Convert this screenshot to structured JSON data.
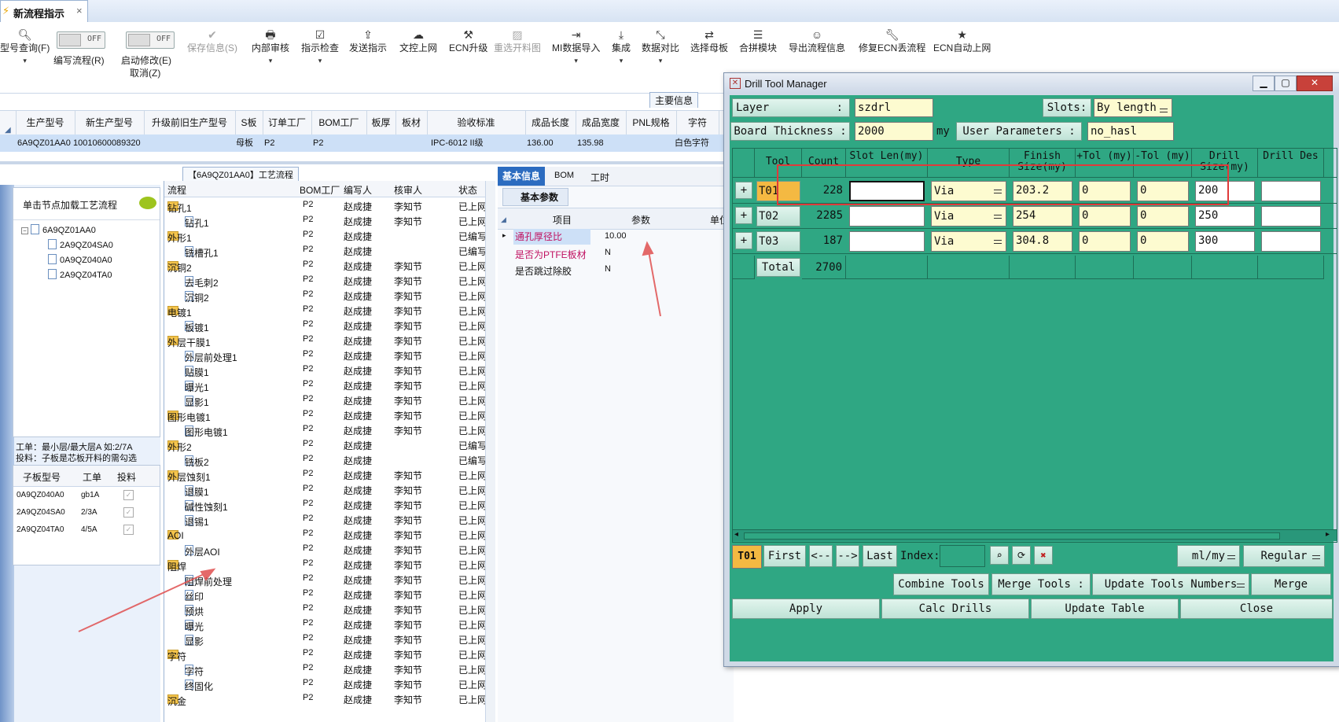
{
  "tab": {
    "title": "新流程指示",
    "close": "×"
  },
  "toolbar": {
    "items": [
      {
        "label": "型号查询(F)",
        "icon": "search-icon"
      },
      {
        "label": "编写流程(R)"
      },
      {
        "label": "启动修改(E)",
        "sub": "取消(Z)"
      },
      {
        "label": "保存信息(S)",
        "icon": "check-icon"
      },
      {
        "label": "内部审核",
        "icon": "print-icon"
      },
      {
        "label": "指示检查",
        "icon": "checkbox-icon"
      },
      {
        "label": "发送指示",
        "icon": "send-icon"
      },
      {
        "label": "文控上网",
        "icon": "cloud-icon"
      },
      {
        "label": "ECN升级",
        "icon": "ecn-icon"
      },
      {
        "label": "重选开料图",
        "icon": "image-icon"
      },
      {
        "label": "MI数据导入",
        "icon": "import-icon"
      },
      {
        "label": "集成",
        "icon": "download-icon"
      },
      {
        "label": "数据对比",
        "icon": "compare-icon"
      },
      {
        "label": "选择母板",
        "icon": "shuffle-icon"
      },
      {
        "label": "合拼模块",
        "icon": "list-icon"
      },
      {
        "label": "导出流程信息",
        "icon": "smile-icon"
      },
      {
        "label": "修复ECN丢流程",
        "icon": "wrench-icon"
      },
      {
        "label": "ECN自动上网",
        "icon": "star-icon"
      }
    ],
    "toggle_text": "OFF",
    "main_info": "主要信息"
  },
  "grid": {
    "headers": [
      "生产型号",
      "新生产型号",
      "升级前旧生产型号",
      "S板",
      "订单工厂",
      "BOM工厂",
      "板厚",
      "板材",
      "验收标准",
      "成品长度",
      "成品宽度",
      "PNL规格",
      "字符"
    ],
    "row": [
      "6A9QZ01AA0",
      "10010600089320",
      "母板",
      "P2",
      "P2",
      "IPC-6012 II级",
      "136.00",
      "135.98",
      "白色字符"
    ]
  },
  "left": {
    "section_label": "【6A9QZ01AA0】工艺流程",
    "tree_title": "单击节点加载工艺流程",
    "tree_root": "6A9QZ01AA0",
    "tree_children": [
      "2A9QZ04SA0",
      "0A9QZ040A0",
      "2A9QZ04TA0"
    ],
    "note1": "工单：最小层/最大层A 如:2/7A",
    "note2": "投料：子板是芯板开料的需勾选",
    "sub_headers": [
      "子板型号",
      "工单",
      "投料"
    ],
    "sub_rows": [
      [
        "0A9QZ040A0",
        "gb1A"
      ],
      [
        "2A9QZ04SA0",
        "2/3A"
      ],
      [
        "2A9QZ04TA0",
        "4/5A"
      ]
    ]
  },
  "process": {
    "headers": [
      "流程",
      "BOM工厂",
      "编写人",
      "核审人",
      "状态"
    ],
    "rows": [
      {
        "name": "钻孔1",
        "lvl": 0,
        "f": "P2",
        "w": "赵成捷",
        "r": "李知节",
        "s": "已上网"
      },
      {
        "name": "钻孔1",
        "lvl": 1,
        "f": "P2",
        "w": "赵成捷",
        "r": "李知节",
        "s": "已上网"
      },
      {
        "name": "外形1",
        "lvl": 0,
        "f": "P2",
        "w": "赵成捷",
        "r": "",
        "s": "已编写"
      },
      {
        "name": "铣槽孔1",
        "lvl": 1,
        "f": "P2",
        "w": "赵成捷",
        "r": "",
        "s": "已编写"
      },
      {
        "name": "沉铜2",
        "lvl": 0,
        "f": "P2",
        "w": "赵成捷",
        "r": "李知节",
        "s": "已上网"
      },
      {
        "name": "去毛刺2",
        "lvl": 1,
        "f": "P2",
        "w": "赵成捷",
        "r": "李知节",
        "s": "已上网"
      },
      {
        "name": "沉铜2",
        "lvl": 1,
        "f": "P2",
        "w": "赵成捷",
        "r": "李知节",
        "s": "已上网"
      },
      {
        "name": "电镀1",
        "lvl": 0,
        "f": "P2",
        "w": "赵成捷",
        "r": "李知节",
        "s": "已上网"
      },
      {
        "name": "板镀1",
        "lvl": 1,
        "f": "P2",
        "w": "赵成捷",
        "r": "李知节",
        "s": "已上网"
      },
      {
        "name": "外层干膜1",
        "lvl": 0,
        "f": "P2",
        "w": "赵成捷",
        "r": "李知节",
        "s": "已上网"
      },
      {
        "name": "外层前处理1",
        "lvl": 1,
        "f": "P2",
        "w": "赵成捷",
        "r": "李知节",
        "s": "已上网"
      },
      {
        "name": "贴膜1",
        "lvl": 1,
        "f": "P2",
        "w": "赵成捷",
        "r": "李知节",
        "s": "已上网"
      },
      {
        "name": "曝光1",
        "lvl": 1,
        "f": "P2",
        "w": "赵成捷",
        "r": "李知节",
        "s": "已上网"
      },
      {
        "name": "显影1",
        "lvl": 1,
        "f": "P2",
        "w": "赵成捷",
        "r": "李知节",
        "s": "已上网"
      },
      {
        "name": "图形电镀1",
        "lvl": 0,
        "f": "P2",
        "w": "赵成捷",
        "r": "李知节",
        "s": "已上网"
      },
      {
        "name": "图形电镀1",
        "lvl": 1,
        "f": "P2",
        "w": "赵成捷",
        "r": "李知节",
        "s": "已上网"
      },
      {
        "name": "外形2",
        "lvl": 0,
        "f": "P2",
        "w": "赵成捷",
        "r": "",
        "s": "已编写"
      },
      {
        "name": "铣板2",
        "lvl": 1,
        "f": "P2",
        "w": "赵成捷",
        "r": "",
        "s": "已编写"
      },
      {
        "name": "外层蚀刻1",
        "lvl": 0,
        "f": "P2",
        "w": "赵成捷",
        "r": "李知节",
        "s": "已上网"
      },
      {
        "name": "退膜1",
        "lvl": 1,
        "f": "P2",
        "w": "赵成捷",
        "r": "李知节",
        "s": "已上网"
      },
      {
        "name": "碱性蚀刻1",
        "lvl": 1,
        "f": "P2",
        "w": "赵成捷",
        "r": "李知节",
        "s": "已上网"
      },
      {
        "name": "退锡1",
        "lvl": 1,
        "f": "P2",
        "w": "赵成捷",
        "r": "李知节",
        "s": "已上网"
      },
      {
        "name": "AOI",
        "lvl": 0,
        "f": "P2",
        "w": "赵成捷",
        "r": "李知节",
        "s": "已上网"
      },
      {
        "name": "外层AOI",
        "lvl": 1,
        "f": "P2",
        "w": "赵成捷",
        "r": "李知节",
        "s": "已上网"
      },
      {
        "name": "阻焊",
        "lvl": 0,
        "f": "P2",
        "w": "赵成捷",
        "r": "李知节",
        "s": "已上网"
      },
      {
        "name": "阻焊前处理",
        "lvl": 1,
        "f": "P2",
        "w": "赵成捷",
        "r": "李知节",
        "s": "已上网"
      },
      {
        "name": "丝印",
        "lvl": 1,
        "f": "P2",
        "w": "赵成捷",
        "r": "李知节",
        "s": "已上网"
      },
      {
        "name": "预烘",
        "lvl": 1,
        "f": "P2",
        "w": "赵成捷",
        "r": "李知节",
        "s": "已上网"
      },
      {
        "name": "曝光",
        "lvl": 1,
        "f": "P2",
        "w": "赵成捷",
        "r": "李知节",
        "s": "已上网"
      },
      {
        "name": "显影",
        "lvl": 1,
        "f": "P2",
        "w": "赵成捷",
        "r": "李知节",
        "s": "已上网"
      },
      {
        "name": "字符",
        "lvl": 0,
        "f": "P2",
        "w": "赵成捷",
        "r": "李知节",
        "s": "已上网"
      },
      {
        "name": "字符",
        "lvl": 1,
        "f": "P2",
        "w": "赵成捷",
        "r": "李知节",
        "s": "已上网"
      },
      {
        "name": "终固化",
        "lvl": 1,
        "f": "P2",
        "w": "赵成捷",
        "r": "李知节",
        "s": "已上网"
      },
      {
        "name": "沉金",
        "lvl": 0,
        "f": "P2",
        "w": "赵成捷",
        "r": "李知节",
        "s": "已上网"
      }
    ]
  },
  "params": {
    "tabs": [
      "基本信息",
      "BOM",
      "工时"
    ],
    "section": "基本参数",
    "headers": [
      "项目",
      "参数",
      "单位"
    ],
    "rows": [
      [
        "通孔厚径比",
        "10.00"
      ],
      [
        "是否为PTFE板材",
        "N"
      ],
      [
        "是否跳过除胶",
        "N"
      ]
    ]
  },
  "dialog": {
    "title": "Drill Tool Manager",
    "layer_label": "Layer",
    "layer_value": "szdrl",
    "slots_label": "Slots:",
    "slots_value": "By length",
    "thickness_label": "Board Thickness :",
    "thickness_value": "2000",
    "thickness_unit": "my",
    "user_params_label": "User Parameters :",
    "user_params_value": "no_hasl",
    "col_headers": [
      "Tool",
      "Count",
      "Slot Len(my)",
      "Type",
      "Finish Size(my)",
      "+Tol (my)",
      "-Tol (my)",
      "Drill Size(my)",
      "Drill Des"
    ],
    "tools": [
      {
        "tool": "T01",
        "count": "228",
        "type": "Via",
        "finish": "203.2",
        "ptol": "0",
        "ntol": "0",
        "drill": "200"
      },
      {
        "tool": "T02",
        "count": "2285",
        "type": "Via",
        "finish": "254",
        "ptol": "0",
        "ntol": "0",
        "drill": "250"
      },
      {
        "tool": "T03",
        "count": "187",
        "type": "Via",
        "finish": "304.8",
        "ptol": "0",
        "ntol": "0",
        "drill": "300"
      }
    ],
    "total_label": "Total",
    "total_count": "2700",
    "nav": {
      "current": "T01",
      "first": "First",
      "prev": "<--",
      "next": "-->",
      "last": "Last",
      "index_label": "Index:",
      "units": "ml/my",
      "mode": "Regular"
    },
    "buttons_row1": {
      "combine": "Combine Tools",
      "merge_label": "Merge Tools :",
      "update_numbers": "Update Tools Numbers",
      "merge": "Merge"
    },
    "buttons_row2": [
      "Apply",
      "Calc Drills",
      "Update Table",
      "Close"
    ]
  },
  "colors": {
    "teal": "#2fa783",
    "annotation": "#e04040",
    "selection": "#cde0f7"
  }
}
